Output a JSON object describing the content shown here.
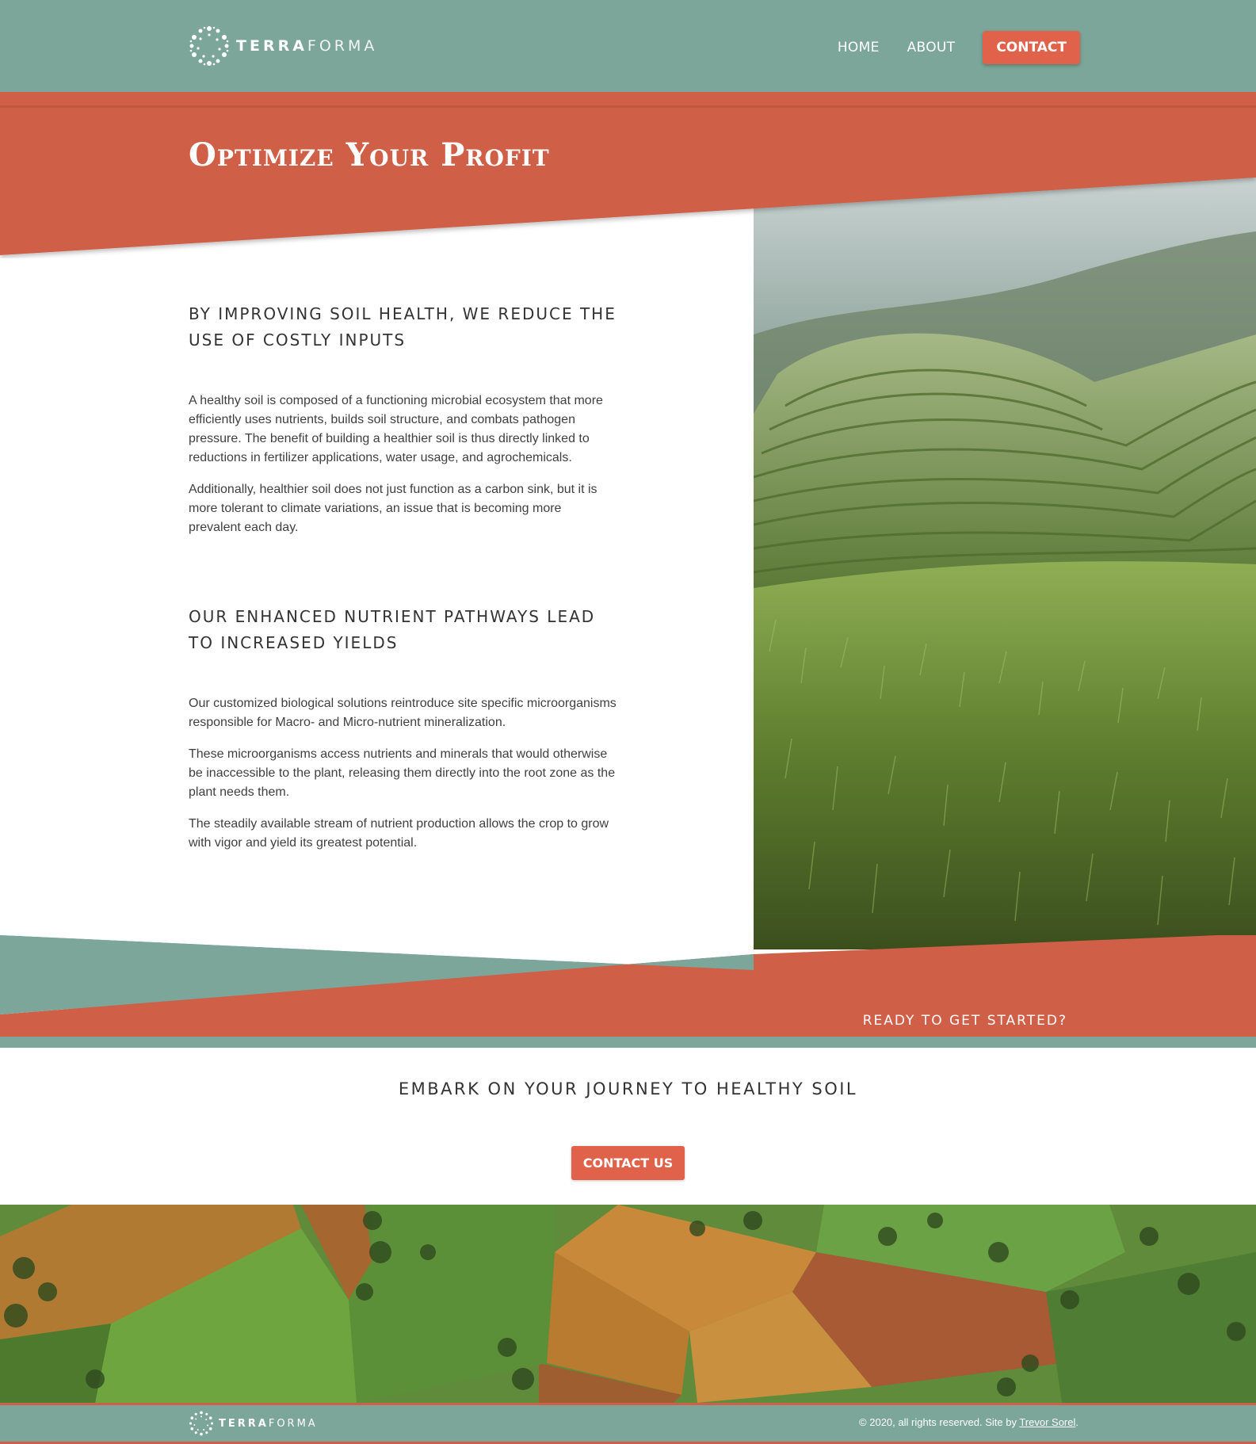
{
  "brand": {
    "name_bold": "TERRA",
    "name_thin": "FORMA"
  },
  "nav": {
    "home": "HOME",
    "about": "ABOUT",
    "contact": "CONTACT"
  },
  "hero": {
    "title": "Optimize Your Profit"
  },
  "sections": [
    {
      "heading": "By improving soil health, we reduce the use of costly inputs",
      "paragraphs": [
        "A healthy soil is composed of a functioning microbial ecosystem that more efficiently uses nutrients, builds soil structure, and combats pathogen pressure. The benefit of building a healthier soil is thus directly linked to reductions in fertilizer applications, water usage, and agrochemicals.",
        "Additionally, healthier soil does not just function as a carbon sink, but it is more tolerant to climate variations, an issue that is becoming more prevalent each day."
      ]
    },
    {
      "heading": "Our enhanced nutrient pathways lead to increased yields",
      "paragraphs": [
        "Our customized biological solutions reintroduce site specific microorganisms responsible for Macro- and Micro-nutrient mineralization.",
        "These microorganisms access nutrients and minerals that would otherwise be inaccessible to the plant, releasing them directly into the root zone as the plant needs them.",
        "The steadily available stream of nutrient production allows the crop to grow with vigor and yield its greatest potential."
      ]
    }
  ],
  "cta": {
    "ready": "Ready to get started?",
    "heading": "Embark on your journey to healthy soil",
    "button": "CONTACT US"
  },
  "footer": {
    "copyright": "© 2020, all rights reserved. Site by ",
    "author_link": "Trevor Sorel",
    "period": "."
  },
  "colors": {
    "teal": "#7ba699",
    "terracotta": "#d05f47",
    "button": "#e0624a"
  },
  "icons": {
    "logo": "dotted-circle-logo-icon"
  }
}
